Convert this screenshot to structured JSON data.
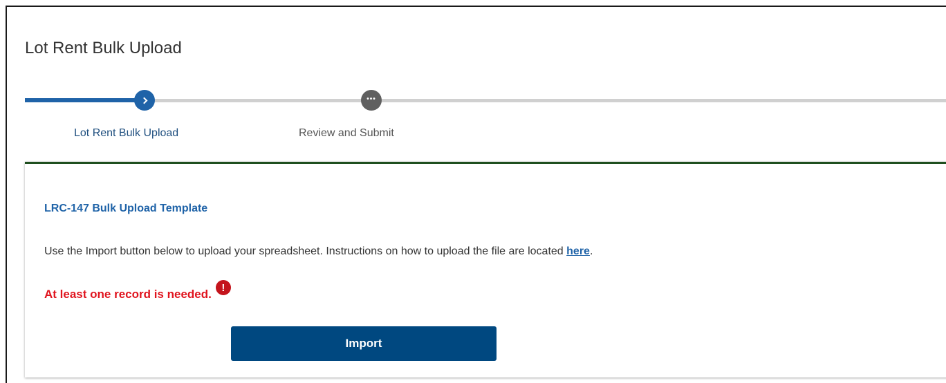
{
  "page": {
    "title": "Lot Rent Bulk Upload"
  },
  "stepper": {
    "steps": [
      {
        "label": "Lot Rent Bulk Upload",
        "state": "active",
        "icon": "chevron-right-icon"
      },
      {
        "label": "Review and Submit",
        "state": "pending",
        "icon": "ellipsis-icon"
      }
    ],
    "pending_glyph": "•••"
  },
  "card": {
    "heading": "LRC-147 Bulk Upload Template",
    "instructions_prefix": "Use the Import button below to upload your spreadsheet. Instructions on how to upload the file are located ",
    "instructions_link": "here",
    "instructions_suffix": ".",
    "error_message": "At least one record is needed.",
    "error_icon_glyph": "!",
    "import_label": "Import"
  },
  "colors": {
    "primary_blue": "#1f63a8",
    "button_blue": "#004880",
    "error_red": "#e0141e",
    "card_accent": "#1f4f1f"
  }
}
